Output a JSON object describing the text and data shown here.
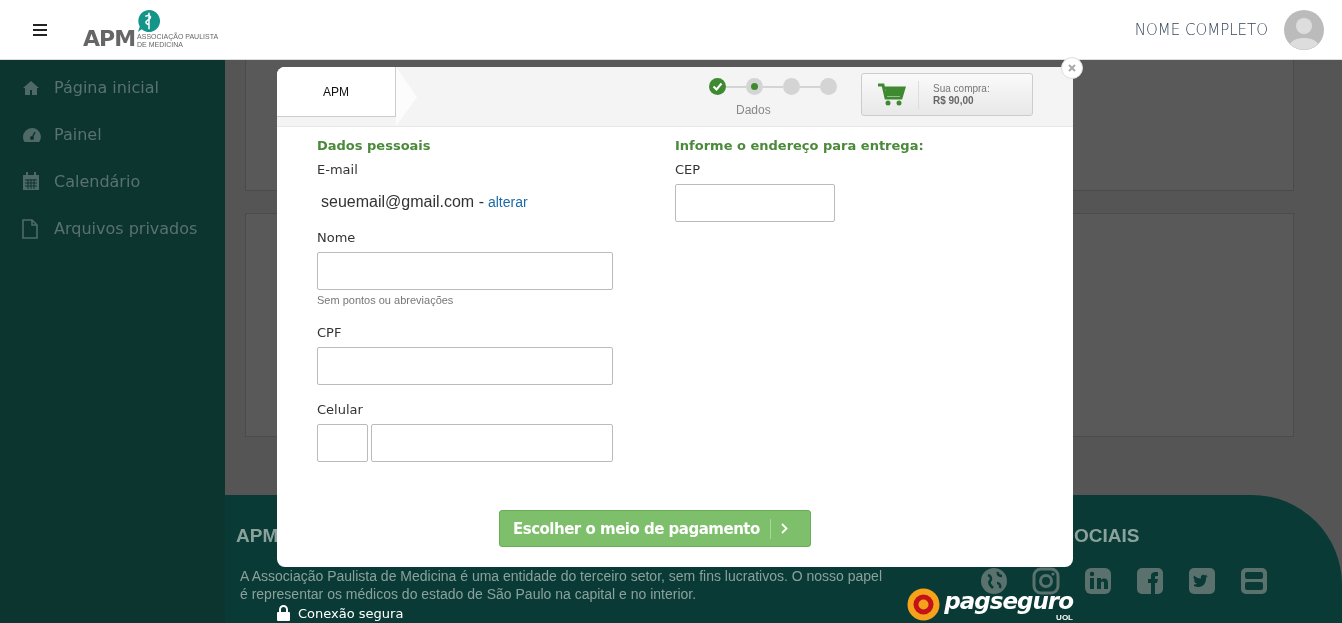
{
  "header": {
    "logo_text": "APM",
    "logo_subtitle": "ASSOCIAÇÃO PAULISTA DE MEDICINA",
    "user_name": "NOME COMPLETO"
  },
  "sidebar": {
    "items": [
      {
        "label": "Página inicial"
      },
      {
        "label": "Painel"
      },
      {
        "label": "Calendário"
      },
      {
        "label": "Arquivos privados"
      }
    ]
  },
  "modal": {
    "tab": "APM",
    "steps": [
      {
        "kind": "done"
      },
      {
        "kind": "current"
      },
      {
        "kind": "todo"
      },
      {
        "kind": "todo"
      }
    ],
    "step_label": "Dados",
    "cart": {
      "label": "Sua compra:",
      "total": "R$ 90,00"
    },
    "personal": {
      "title": "Dados pessoais",
      "email_label": "E-mail",
      "email": "seuemail@gmail.com -",
      "email_link": "alterar",
      "fields": [
        {
          "label": "Nome",
          "kind": "text",
          "hint": "Sem pontos ou abreviações"
        },
        {
          "label": "CPF",
          "kind": "text"
        },
        {
          "label": "Celular",
          "kind": "phone"
        }
      ]
    },
    "address": {
      "title": "Informe o endereço para entrega:",
      "fields": [
        {
          "label": "CEP",
          "kind": "short"
        }
      ]
    },
    "submit": "Escolher o meio de pagamento"
  },
  "footer": {
    "heading_left": "APM",
    "heading_right": "OCIAIS",
    "lines": [
      "A Associação Paulista de Medicina é uma entidade do terceiro setor, sem fins lucrativos. O nosso papel",
      "é representar os médicos do estado de São Paulo na capital e no interior."
    ]
  },
  "secure_label": "Conexão segura",
  "pagseguro": {
    "name": "pagseguro",
    "sub": "UOL"
  }
}
